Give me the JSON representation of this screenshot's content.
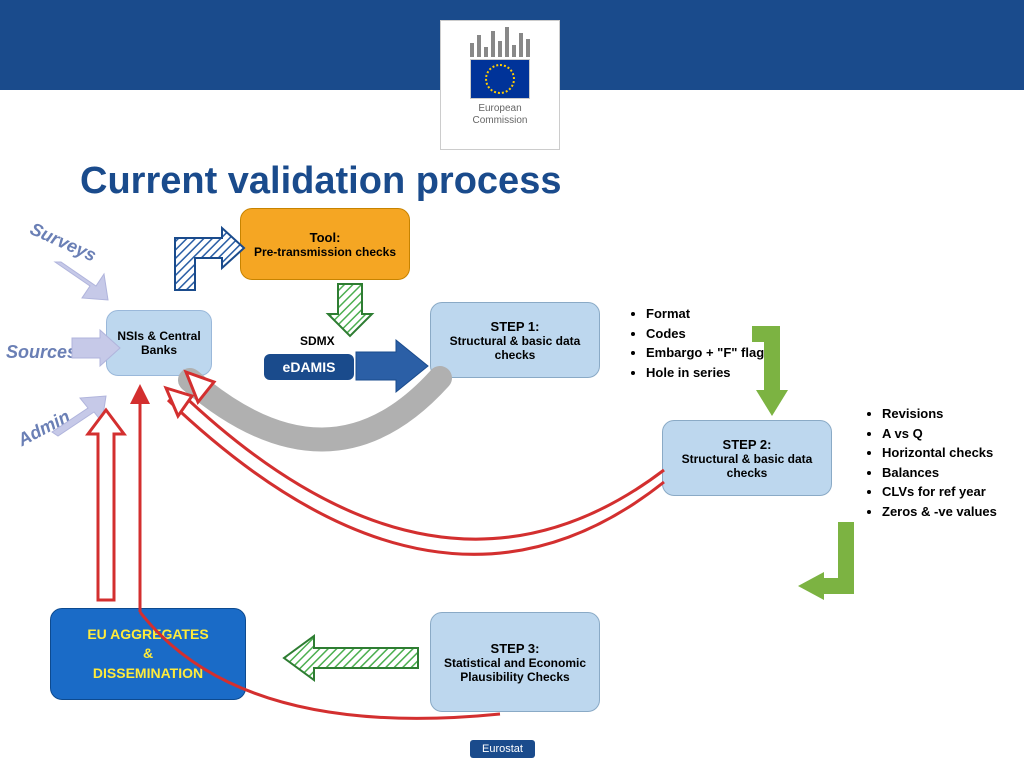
{
  "header": {
    "org_line1": "European",
    "org_line2": "Commission"
  },
  "title": "Current validation process",
  "tool_box": {
    "title": "Tool:",
    "subtitle": "Pre-transmission checks"
  },
  "nsi_box": "NSIs & Central Banks",
  "edamis": "eDAMIS",
  "sdmx": "SDMX",
  "step1": {
    "title": "STEP 1:",
    "subtitle": "Structural & basic data checks"
  },
  "step2": {
    "title": "STEP 2:",
    "subtitle": "Structural & basic data checks"
  },
  "step3": {
    "title": "STEP 3:",
    "subtitle": "Statistical and Economic Plausibility Checks"
  },
  "aggregates": {
    "line1": "EU AGGREGATES",
    "line2": "&",
    "line3": "DISSEMINATION"
  },
  "inputs": {
    "surveys": "Surveys",
    "sources": "Sources",
    "admin": "Admin"
  },
  "step1_bullets": [
    "Format",
    "Codes",
    "Embargo + \"F\" flag",
    "Hole in series"
  ],
  "step2_bullets": [
    "Revisions",
    "A vs Q",
    "Horizontal checks",
    "Balances",
    "CLVs for ref year",
    "Zeros  & -ve values"
  ],
  "footer": "Eurostat"
}
